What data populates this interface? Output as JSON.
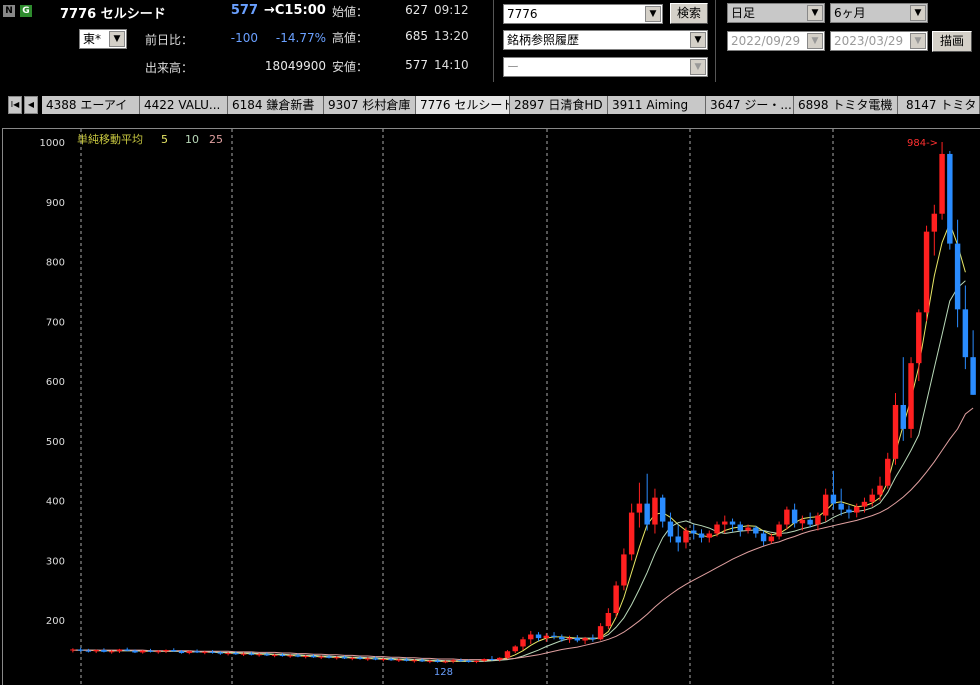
{
  "badges": {
    "n": "N",
    "g": "G"
  },
  "stock": {
    "title": "7776 セルシード",
    "price": "577",
    "price_time": "→C15:00"
  },
  "market_select": {
    "value": "東*"
  },
  "quote": {
    "change_label": "前日比：",
    "change_value": "-100",
    "change_pct": "-14.77%",
    "volume_label": "出来高：",
    "volume_value": "18049900",
    "open_label": "始値：",
    "open_value": "627",
    "open_time": "09:12",
    "high_label": "高値：",
    "high_value": "685",
    "high_time": "13:20",
    "low_label": "安値：",
    "low_value": "577",
    "low_time": "14:10"
  },
  "search": {
    "code_value": "7776",
    "button_label": "検索",
    "history_value": "銘柄参照履歴",
    "third_value": "ー"
  },
  "period": {
    "interval_value": "日足",
    "span_value": "6ヶ月",
    "date_from": "2022/09/29",
    "date_to": "2023/03/29",
    "draw_label": "描画"
  },
  "tabs": {
    "nav_first": "I◀",
    "nav_prev": "◀",
    "items": [
      "4388 エーアイ",
      "4422 VALU...",
      "6184 鎌倉新書",
      "9307 杉村倉庫",
      "7776 セルシード",
      "2897 日清食HD",
      "3911 Aiming",
      "3647 ジー・...",
      "6898 トミタ電機",
      "8147 トミタ"
    ]
  },
  "legend": {
    "title": "単純移動平均",
    "ma5": "5",
    "ma10": "10",
    "ma25": "25"
  },
  "colors": {
    "up": "#ff2020",
    "down": "#2a8cff",
    "ma5": "#e8e866",
    "ma10": "#b8d8b8",
    "ma25": "#e0a0a0",
    "grid": "#aaaaaa",
    "price_blue": "#6aa0ff"
  },
  "chart_data": {
    "type": "candlestick",
    "y_ticks": [
      "1000",
      "900",
      "800",
      "700",
      "600",
      "500",
      "400",
      "300",
      "200"
    ],
    "ylim": [
      125,
      1005
    ],
    "annotations": {
      "high_marker": "984->",
      "low_marker": "128"
    },
    "series": [
      {
        "type": "candles",
        "values": [
          [
            150,
            153,
            146,
            151
          ],
          [
            151,
            154,
            147,
            149
          ],
          [
            149,
            152,
            146,
            148
          ],
          [
            148,
            151,
            145,
            150
          ],
          [
            150,
            153,
            146,
            147
          ],
          [
            147,
            150,
            144,
            148
          ],
          [
            148,
            152,
            145,
            151
          ],
          [
            151,
            154,
            148,
            149
          ],
          [
            149,
            151,
            145,
            146
          ],
          [
            146,
            150,
            144,
            149
          ],
          [
            149,
            152,
            146,
            147
          ],
          [
            147,
            150,
            144,
            148
          ],
          [
            148,
            151,
            145,
            150
          ],
          [
            150,
            153,
            147,
            148
          ],
          [
            148,
            150,
            144,
            145
          ],
          [
            145,
            149,
            143,
            148
          ],
          [
            148,
            151,
            145,
            146
          ],
          [
            146,
            149,
            143,
            147
          ],
          [
            147,
            150,
            144,
            146
          ],
          [
            146,
            148,
            142,
            144
          ],
          [
            144,
            147,
            141,
            145
          ],
          [
            145,
            148,
            142,
            143
          ],
          [
            143,
            146,
            140,
            144
          ],
          [
            144,
            147,
            141,
            142
          ],
          [
            142,
            145,
            139,
            143
          ],
          [
            143,
            146,
            140,
            141
          ],
          [
            141,
            144,
            138,
            142
          ],
          [
            142,
            145,
            139,
            140
          ],
          [
            140,
            143,
            137,
            141
          ],
          [
            141,
            144,
            138,
            139
          ],
          [
            139,
            142,
            136,
            140
          ],
          [
            140,
            143,
            137,
            138
          ],
          [
            138,
            141,
            135,
            139
          ],
          [
            139,
            142,
            136,
            137
          ],
          [
            137,
            140,
            134,
            138
          ],
          [
            138,
            141,
            135,
            136
          ],
          [
            136,
            139,
            133,
            137
          ],
          [
            137,
            140,
            134,
            135
          ],
          [
            135,
            138,
            132,
            136
          ],
          [
            136,
            139,
            133,
            134
          ],
          [
            134,
            137,
            131,
            135
          ],
          [
            135,
            138,
            132,
            133
          ],
          [
            133,
            136,
            130,
            134
          ],
          [
            134,
            137,
            131,
            132
          ],
          [
            132,
            135,
            129,
            133
          ],
          [
            133,
            136,
            130,
            131
          ],
          [
            131,
            134,
            128,
            132
          ],
          [
            132,
            135,
            129,
            130
          ],
          [
            130,
            133,
            128,
            131
          ],
          [
            131,
            135,
            128,
            133
          ],
          [
            133,
            136,
            130,
            132
          ],
          [
            132,
            134,
            129,
            130
          ],
          [
            130,
            133,
            128,
            132
          ],
          [
            132,
            136,
            130,
            135
          ],
          [
            135,
            140,
            132,
            134
          ],
          [
            134,
            138,
            131,
            137
          ],
          [
            137,
            150,
            135,
            148
          ],
          [
            148,
            158,
            145,
            156
          ],
          [
            156,
            172,
            150,
            168
          ],
          [
            168,
            182,
            160,
            176
          ],
          [
            176,
            180,
            165,
            170
          ],
          [
            170,
            178,
            164,
            174
          ],
          [
            174,
            180,
            168,
            172
          ],
          [
            172,
            176,
            164,
            168
          ],
          [
            168,
            174,
            162,
            170
          ],
          [
            170,
            175,
            163,
            166
          ],
          [
            166,
            172,
            160,
            170
          ],
          [
            170,
            176,
            164,
            168
          ],
          [
            168,
            195,
            166,
            190
          ],
          [
            190,
            220,
            185,
            212
          ],
          [
            212,
            265,
            205,
            258
          ],
          [
            258,
            320,
            250,
            310
          ],
          [
            310,
            395,
            300,
            380
          ],
          [
            380,
            430,
            355,
            395
          ],
          [
            395,
            445,
            350,
            360
          ],
          [
            360,
            420,
            345,
            405
          ],
          [
            405,
            410,
            355,
            365
          ],
          [
            365,
            380,
            330,
            340
          ],
          [
            340,
            360,
            315,
            330
          ],
          [
            330,
            355,
            320,
            350
          ],
          [
            350,
            360,
            335,
            345
          ],
          [
            345,
            352,
            330,
            338
          ],
          [
            338,
            350,
            330,
            345
          ],
          [
            345,
            365,
            340,
            360
          ],
          [
            360,
            375,
            345,
            365
          ],
          [
            365,
            370,
            348,
            360
          ],
          [
            360,
            365,
            340,
            350
          ],
          [
            350,
            360,
            345,
            355
          ],
          [
            355,
            358,
            338,
            345
          ],
          [
            345,
            350,
            325,
            332
          ],
          [
            332,
            345,
            328,
            340
          ],
          [
            340,
            365,
            335,
            360
          ],
          [
            360,
            390,
            352,
            385
          ],
          [
            385,
            395,
            355,
            362
          ],
          [
            362,
            375,
            350,
            368
          ],
          [
            368,
            380,
            355,
            360
          ],
          [
            360,
            380,
            350,
            375
          ],
          [
            375,
            420,
            365,
            410
          ],
          [
            410,
            450,
            385,
            395
          ],
          [
            395,
            420,
            375,
            385
          ],
          [
            385,
            392,
            370,
            380
          ],
          [
            380,
            395,
            372,
            390
          ],
          [
            390,
            405,
            380,
            398
          ],
          [
            398,
            420,
            390,
            410
          ],
          [
            410,
            440,
            400,
            425
          ],
          [
            425,
            480,
            420,
            470
          ],
          [
            470,
            580,
            460,
            560
          ],
          [
            560,
            640,
            500,
            520
          ],
          [
            520,
            640,
            505,
            630
          ],
          [
            630,
            720,
            600,
            715
          ],
          [
            715,
            860,
            700,
            850
          ],
          [
            850,
            895,
            810,
            880
          ],
          [
            880,
            1000,
            870,
            980
          ],
          [
            980,
            985,
            820,
            830
          ],
          [
            830,
            870,
            690,
            720
          ],
          [
            720,
            760,
            620,
            640
          ],
          [
            640,
            685,
            577,
            577
          ]
        ]
      },
      {
        "type": "ma",
        "name": "5",
        "values": [
          150,
          150,
          150,
          149,
          149,
          149,
          149,
          149,
          149,
          148,
          148,
          148,
          148,
          148,
          148,
          147,
          147,
          147,
          146,
          146,
          145,
          145,
          144,
          144,
          143,
          143,
          142,
          142,
          141,
          140,
          140,
          139,
          139,
          138,
          138,
          137,
          137,
          136,
          136,
          135,
          135,
          134,
          134,
          133,
          133,
          132,
          132,
          131,
          131,
          131,
          131,
          131,
          131,
          132,
          133,
          134,
          137,
          142,
          149,
          158,
          165,
          170,
          172,
          172,
          171,
          170,
          169,
          168,
          171,
          181,
          205,
          238,
          280,
          322,
          360,
          377,
          380,
          372,
          360,
          350,
          346,
          342,
          339,
          343,
          350,
          354,
          356,
          358,
          357,
          349,
          343,
          345,
          353,
          363,
          370,
          372,
          373,
          383,
          396,
          398,
          394,
          390,
          391,
          396,
          405,
          431,
          480,
          526,
          570,
          624,
          701,
          776,
          832,
          864,
          828,
          782
        ]
      },
      {
        "type": "ma",
        "name": "10",
        "values": [
          150,
          150,
          150,
          150,
          149,
          149,
          149,
          149,
          149,
          149,
          149,
          148,
          148,
          148,
          148,
          147,
          147,
          147,
          147,
          146,
          146,
          146,
          145,
          145,
          144,
          144,
          143,
          143,
          142,
          142,
          141,
          141,
          140,
          140,
          139,
          139,
          138,
          138,
          137,
          137,
          136,
          136,
          135,
          135,
          134,
          134,
          133,
          133,
          132,
          132,
          132,
          132,
          131,
          131,
          132,
          133,
          134,
          136,
          140,
          145,
          150,
          156,
          161,
          166,
          169,
          170,
          170,
          170,
          170,
          176,
          188,
          204,
          226,
          252,
          280,
          311,
          338,
          356,
          363,
          366,
          361,
          358,
          354,
          348,
          345,
          347,
          349,
          350,
          351,
          350,
          347,
          345,
          346,
          349,
          353,
          356,
          360,
          364,
          372,
          378,
          382,
          382,
          384,
          388,
          396,
          414,
          439,
          461,
          484,
          510,
          566,
          622,
          678,
          734,
          756,
          768
        ]
      },
      {
        "type": "ma",
        "name": "25",
        "values": [
          150,
          150,
          150,
          150,
          150,
          150,
          150,
          150,
          150,
          150,
          149,
          149,
          149,
          149,
          149,
          149,
          148,
          148,
          148,
          148,
          148,
          147,
          147,
          147,
          146,
          146,
          146,
          145,
          145,
          144,
          144,
          143,
          143,
          142,
          142,
          141,
          141,
          140,
          140,
          139,
          139,
          138,
          138,
          137,
          137,
          136,
          136,
          135,
          135,
          135,
          134,
          134,
          134,
          134,
          134,
          134,
          135,
          136,
          138,
          140,
          142,
          145,
          148,
          151,
          153,
          155,
          158,
          161,
          164,
          168,
          173,
          180,
          189,
          199,
          210,
          222,
          233,
          243,
          252,
          260,
          267,
          274,
          281,
          288,
          295,
          302,
          308,
          314,
          319,
          324,
          328,
          331,
          336,
          340,
          345,
          349,
          352,
          355,
          358,
          361,
          364,
          367,
          371,
          375,
          380,
          387,
          396,
          406,
          418,
          432,
          448,
          465,
          484,
          503,
          520,
          545,
          555
        ]
      }
    ]
  }
}
